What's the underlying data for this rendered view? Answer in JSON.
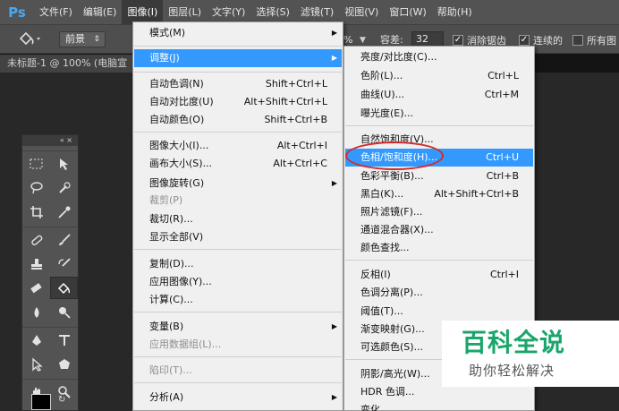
{
  "app": {
    "logo": "Ps"
  },
  "menubar": {
    "items": [
      "文件(F)",
      "编辑(E)",
      "图像(I)",
      "图层(L)",
      "文字(Y)",
      "选择(S)",
      "滤镜(T)",
      "视图(V)",
      "窗口(W)",
      "帮助(H)"
    ],
    "active": "图像(I)"
  },
  "options": {
    "foreground_select": "前景",
    "opacity_suffix": "%",
    "tolerance_label": "容差:",
    "tolerance_value": "32",
    "antialias_label": "消除锯齿",
    "contiguous_label": "连续的",
    "all_layers_label": "所有图",
    "antialias_checked": true,
    "contiguous_checked": true,
    "all_layers_checked": false
  },
  "document": {
    "tab_title": "未标题-1 @ 100% (电脑宣"
  },
  "image_menu": {
    "items": [
      {
        "label": "模式(M)",
        "shortcut": "",
        "submenu": true,
        "disabled": false
      },
      {
        "label": "调整(J)",
        "shortcut": "",
        "submenu": true,
        "disabled": false,
        "highlighted": true
      },
      {
        "label": "自动色调(N)",
        "shortcut": "Shift+Ctrl+L",
        "submenu": false,
        "disabled": false
      },
      {
        "label": "自动对比度(U)",
        "shortcut": "Alt+Shift+Ctrl+L",
        "submenu": false,
        "disabled": false
      },
      {
        "label": "自动颜色(O)",
        "shortcut": "Shift+Ctrl+B",
        "submenu": false,
        "disabled": false
      },
      {
        "label": "图像大小(I)...",
        "shortcut": "Alt+Ctrl+I",
        "submenu": false,
        "disabled": false
      },
      {
        "label": "画布大小(S)...",
        "shortcut": "Alt+Ctrl+C",
        "submenu": false,
        "disabled": false
      },
      {
        "label": "图像旋转(G)",
        "shortcut": "",
        "submenu": true,
        "disabled": false
      },
      {
        "label": "裁剪(P)",
        "shortcut": "",
        "submenu": false,
        "disabled": true
      },
      {
        "label": "裁切(R)...",
        "shortcut": "",
        "submenu": false,
        "disabled": false
      },
      {
        "label": "显示全部(V)",
        "shortcut": "",
        "submenu": false,
        "disabled": false
      },
      {
        "label": "复制(D)...",
        "shortcut": "",
        "submenu": false,
        "disabled": false
      },
      {
        "label": "应用图像(Y)...",
        "shortcut": "",
        "submenu": false,
        "disabled": false
      },
      {
        "label": "计算(C)...",
        "shortcut": "",
        "submenu": false,
        "disabled": false
      },
      {
        "label": "变量(B)",
        "shortcut": "",
        "submenu": true,
        "disabled": false
      },
      {
        "label": "应用数据组(L)...",
        "shortcut": "",
        "submenu": false,
        "disabled": true
      },
      {
        "label": "陷印(T)...",
        "shortcut": "",
        "submenu": false,
        "disabled": true
      },
      {
        "label": "分析(A)",
        "shortcut": "",
        "submenu": true,
        "disabled": false
      }
    ]
  },
  "adjust_menu": {
    "items": [
      {
        "label": "亮度/对比度(C)...",
        "shortcut": ""
      },
      {
        "label": "色阶(L)...",
        "shortcut": "Ctrl+L"
      },
      {
        "label": "曲线(U)...",
        "shortcut": "Ctrl+M"
      },
      {
        "label": "曝光度(E)...",
        "shortcut": ""
      },
      {
        "label": "自然饱和度(V)...",
        "shortcut": ""
      },
      {
        "label": "色相/饱和度(H)...",
        "shortcut": "Ctrl+U",
        "highlighted": true
      },
      {
        "label": "色彩平衡(B)...",
        "shortcut": "Ctrl+B"
      },
      {
        "label": "黑白(K)...",
        "shortcut": "Alt+Shift+Ctrl+B"
      },
      {
        "label": "照片滤镜(F)...",
        "shortcut": ""
      },
      {
        "label": "通道混合器(X)...",
        "shortcut": ""
      },
      {
        "label": "颜色查找...",
        "shortcut": ""
      },
      {
        "label": "反相(I)",
        "shortcut": "Ctrl+I"
      },
      {
        "label": "色调分离(P)...",
        "shortcut": ""
      },
      {
        "label": "阈值(T)...",
        "shortcut": ""
      },
      {
        "label": "渐变映射(G)...",
        "shortcut": ""
      },
      {
        "label": "可选颜色(S)...",
        "shortcut": ""
      },
      {
        "label": "阴影/高光(W)...",
        "shortcut": ""
      },
      {
        "label": "HDR 色调...",
        "shortcut": ""
      },
      {
        "label": "变化...",
        "shortcut": ""
      }
    ]
  },
  "watermark": {
    "title": "百科全说",
    "subtitle": "助你轻松解决"
  },
  "colors": {
    "menu_highlight": "#3399ff",
    "annotation": "#d42a2a",
    "brand": "#1aa66a",
    "ps_blue": "#4aa9ee"
  }
}
